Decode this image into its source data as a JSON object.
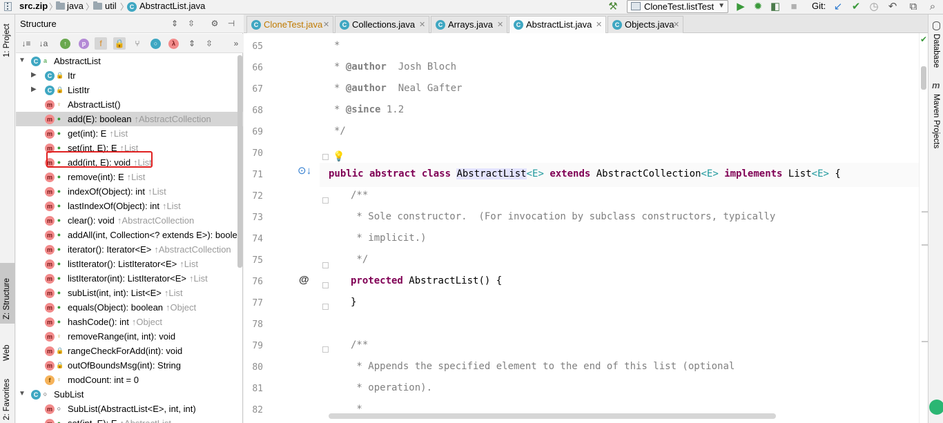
{
  "breadcrumb": {
    "items": [
      {
        "label": "src.zip",
        "icon": "zip-icon"
      },
      {
        "label": "java",
        "icon": "folder-icon"
      },
      {
        "label": "util",
        "icon": "folder-icon"
      },
      {
        "label": "AbstractList.java",
        "icon": "class-icon"
      }
    ],
    "separator": "〉"
  },
  "toolbar": {
    "run_config": "CloneTest.listTest",
    "git_label": "Git:"
  },
  "left_stripe": {
    "project": "1: Project",
    "structure": "Z: Structure",
    "web": "Web",
    "favorites": "2: Favorites"
  },
  "right_stripe": {
    "database": "Database",
    "maven": "Maven Projects",
    "maven_glyph": "m"
  },
  "structure": {
    "title": "Structure",
    "tree": [
      {
        "label": "AbstractList",
        "inherited": "",
        "icon": "class-icon",
        "glyph": "C",
        "vis": "pub",
        "vis_glyph": "a",
        "indent": 0,
        "arrow": "expanded"
      },
      {
        "label": "Itr",
        "inherited": "",
        "icon": "class-icon",
        "glyph": "C",
        "vis": "priv",
        "vis_glyph": "🔒",
        "indent": 1,
        "arrow": "collapsed"
      },
      {
        "label": "ListItr",
        "inherited": "",
        "icon": "class-icon",
        "glyph": "C",
        "vis": "priv",
        "vis_glyph": "🔒",
        "indent": 1,
        "arrow": "collapsed"
      },
      {
        "label": "AbstractList()",
        "inherited": "",
        "icon": "method-icon",
        "glyph": "m",
        "vis": "prot",
        "vis_glyph": "♀",
        "indent": 1,
        "arrow": ""
      },
      {
        "label": "add(E): boolean",
        "inherited": "↑AbstractCollection",
        "icon": "method-icon",
        "glyph": "m",
        "vis": "pub",
        "vis_glyph": "●",
        "indent": 1,
        "arrow": "",
        "selected": true
      },
      {
        "label": "get(int): E",
        "inherited": "↑List",
        "icon": "method-icon",
        "glyph": "m",
        "vis": "pub",
        "vis_glyph": "●",
        "indent": 1,
        "arrow": ""
      },
      {
        "label": "set(int, E): E",
        "inherited": "↑List",
        "icon": "method-icon",
        "glyph": "m",
        "vis": "pub",
        "vis_glyph": "●",
        "indent": 1,
        "arrow": ""
      },
      {
        "label": "add(int, E): void",
        "inherited": "↑List",
        "icon": "method-icon",
        "glyph": "m",
        "vis": "pub",
        "vis_glyph": "●",
        "indent": 1,
        "arrow": ""
      },
      {
        "label": "remove(int): E",
        "inherited": "↑List",
        "icon": "method-icon",
        "glyph": "m",
        "vis": "pub",
        "vis_glyph": "●",
        "indent": 1,
        "arrow": ""
      },
      {
        "label": "indexOf(Object): int",
        "inherited": "↑List",
        "icon": "method-icon",
        "glyph": "m",
        "vis": "pub",
        "vis_glyph": "●",
        "indent": 1,
        "arrow": ""
      },
      {
        "label": "lastIndexOf(Object): int",
        "inherited": "↑List",
        "icon": "method-icon",
        "glyph": "m",
        "vis": "pub",
        "vis_glyph": "●",
        "indent": 1,
        "arrow": ""
      },
      {
        "label": "clear(): void",
        "inherited": "↑AbstractCollection",
        "icon": "method-icon",
        "glyph": "m",
        "vis": "pub",
        "vis_glyph": "●",
        "indent": 1,
        "arrow": ""
      },
      {
        "label": "addAll(int, Collection<? extends E>): boolea",
        "inherited": "",
        "icon": "method-icon",
        "glyph": "m",
        "vis": "pub",
        "vis_glyph": "●",
        "indent": 1,
        "arrow": ""
      },
      {
        "label": "iterator(): Iterator<E>",
        "inherited": "↑AbstractCollection",
        "icon": "method-icon",
        "glyph": "m",
        "vis": "pub",
        "vis_glyph": "●",
        "indent": 1,
        "arrow": ""
      },
      {
        "label": "listIterator(): ListIterator<E>",
        "inherited": "↑List",
        "icon": "method-icon",
        "glyph": "m",
        "vis": "pub",
        "vis_glyph": "●",
        "indent": 1,
        "arrow": ""
      },
      {
        "label": "listIterator(int): ListIterator<E>",
        "inherited": "↑List",
        "icon": "method-icon",
        "glyph": "m",
        "vis": "pub",
        "vis_glyph": "●",
        "indent": 1,
        "arrow": ""
      },
      {
        "label": "subList(int, int): List<E>",
        "inherited": "↑List",
        "icon": "method-icon",
        "glyph": "m",
        "vis": "pub",
        "vis_glyph": "●",
        "indent": 1,
        "arrow": ""
      },
      {
        "label": "equals(Object): boolean",
        "inherited": "↑Object",
        "icon": "method-icon",
        "glyph": "m",
        "vis": "pub",
        "vis_glyph": "●",
        "indent": 1,
        "arrow": ""
      },
      {
        "label": "hashCode(): int",
        "inherited": "↑Object",
        "icon": "method-icon",
        "glyph": "m",
        "vis": "pub",
        "vis_glyph": "●",
        "indent": 1,
        "arrow": ""
      },
      {
        "label": "removeRange(int, int): void",
        "inherited": "",
        "icon": "method-icon",
        "glyph": "m",
        "vis": "prot",
        "vis_glyph": "♀",
        "indent": 1,
        "arrow": ""
      },
      {
        "label": "rangeCheckForAdd(int): void",
        "inherited": "",
        "icon": "method-icon",
        "glyph": "m",
        "vis": "priv",
        "vis_glyph": "🔒",
        "indent": 1,
        "arrow": ""
      },
      {
        "label": "outOfBoundsMsg(int): String",
        "inherited": "",
        "icon": "method-icon",
        "glyph": "m",
        "vis": "priv",
        "vis_glyph": "🔒",
        "indent": 1,
        "arrow": ""
      },
      {
        "label": "modCount: int = 0",
        "inherited": "",
        "icon": "field-icon",
        "glyph": "f",
        "vis": "prot",
        "vis_glyph": "♀",
        "indent": 1,
        "arrow": ""
      },
      {
        "label": "SubList",
        "inherited": "",
        "icon": "class-icon",
        "glyph": "C",
        "vis": "pkg",
        "vis_glyph": "○",
        "indent": 0,
        "arrow": "expanded"
      },
      {
        "label": "SubList(AbstractList<E>, int, int)",
        "inherited": "",
        "icon": "method-icon",
        "glyph": "m",
        "vis": "pkg",
        "vis_glyph": "○",
        "indent": 1,
        "arrow": ""
      },
      {
        "label": "set(int, E): E",
        "inherited": "↑AbstractList",
        "icon": "method-icon",
        "glyph": "m",
        "vis": "pub",
        "vis_glyph": "●",
        "indent": 1,
        "arrow": ""
      }
    ]
  },
  "tabs": [
    {
      "label": "CloneTest.java",
      "modified": true
    },
    {
      "label": "Collections.java",
      "modified": false
    },
    {
      "label": "Arrays.java",
      "modified": false
    },
    {
      "label": "AbstractList.java",
      "modified": false,
      "active": true
    },
    {
      "label": "Objects.java",
      "modified": false
    }
  ],
  "editor": {
    "lines": [
      {
        "n": "65",
        "html": "<span class=\"cm\">*</span>",
        "indent": 1
      },
      {
        "n": "66",
        "html": "<span class=\"cm\">* </span><span class=\"tag\">@author</span><span class=\"cm\">  Josh Bloch</span>",
        "indent": 1
      },
      {
        "n": "67",
        "html": "<span class=\"cm\">* </span><span class=\"tag\">@author</span><span class=\"cm\">  Neal Gafter</span>",
        "indent": 1
      },
      {
        "n": "68",
        "html": "<span class=\"cm\">* </span><span class=\"tag\">@since</span><span class=\"cm\"> 1.2</span>",
        "indent": 1
      },
      {
        "n": "69",
        "html": "<span class=\"cm\">*/</span>",
        "indent": 1
      },
      {
        "n": "70",
        "html": "",
        "indent": 0
      },
      {
        "n": "71",
        "html": "<span class=\"kwp\">public abstract class </span><span class=\"mark-bg\">AbstractList</span><span class=\"ty\">&lt;E&gt;</span><span class=\"kwp\"> extends </span><span class=\"kw\" style=\"font-weight:normal;color:#000\">AbstractCollection</span><span class=\"ty\">&lt;E&gt;</span><span class=\"kwp\"> implements </span>List<span class=\"ty\">&lt;E&gt;</span> {",
        "indent": 0
      },
      {
        "n": "72",
        "html": "<span class=\"cm\">/**</span>",
        "indent": 2
      },
      {
        "n": "73",
        "html": "<span class=\"cm\"> * Sole constructor.  (For invocation by subclass constructors, typically</span>",
        "indent": 2
      },
      {
        "n": "74",
        "html": "<span class=\"cm\"> * implicit.)</span>",
        "indent": 2
      },
      {
        "n": "75",
        "html": "<span class=\"cm\"> */</span>",
        "indent": 2
      },
      {
        "n": "76",
        "html": "<span class=\"kwp\">protected </span>AbstractList() {",
        "indent": 2
      },
      {
        "n": "77",
        "html": "}",
        "indent": 2
      },
      {
        "n": "78",
        "html": "",
        "indent": 0
      },
      {
        "n": "79",
        "html": "<span class=\"cm\">/**</span>",
        "indent": 2
      },
      {
        "n": "80",
        "html": "<span class=\"cm\"> * Appends the specified element to the end of this list (optional</span>",
        "indent": 2
      },
      {
        "n": "81",
        "html": "<span class=\"cm\"> * operation).</span>",
        "indent": 2
      },
      {
        "n": "82",
        "html": "<span class=\"cm\"> *</span>",
        "indent": 2
      }
    ]
  },
  "colors": {
    "accent": "#3fa7c2",
    "highlight_box": "#e02020",
    "keyword": "#800055",
    "comment": "#808080"
  }
}
